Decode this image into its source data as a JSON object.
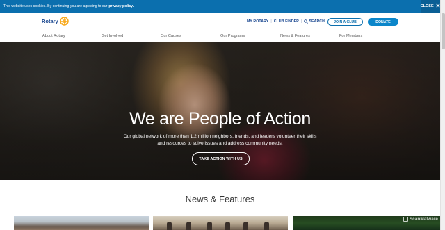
{
  "cookie_bar": {
    "text": "This website uses cookies. By continuing you are agreeing to our",
    "link": "privacy policy.",
    "close_label": "CLOSE",
    "close_glyph": "✕"
  },
  "header": {
    "logo_text": "Rotary",
    "utility_nav": [
      {
        "label": "MY ROTARY"
      },
      {
        "label": "CLUB FINDER"
      },
      {
        "label": "SEARCH",
        "icon": "search-icon"
      }
    ],
    "join_label": "JOIN A CLUB",
    "donate_label": "DONATE"
  },
  "main_nav": [
    {
      "label": "About Rotary"
    },
    {
      "label": "Get Involved"
    },
    {
      "label": "Our Causes"
    },
    {
      "label": "Our Programs"
    },
    {
      "label": "News & Features"
    },
    {
      "label": "For Members"
    }
  ],
  "hero": {
    "title": "We are People of Action",
    "subtitle": "Our global network of more than 1.2 million neighbors, friends, and leaders volunteer their skills and resources to solve issues and address community needs.",
    "cta_label": "TAKE ACTION WITH US"
  },
  "news": {
    "title": "News & Features"
  },
  "watermark": {
    "text": "ScanMalware"
  },
  "colors": {
    "brand_blue": "#17458f",
    "cookie_blue": "#0b6fae",
    "donate_blue": "#0b86ca",
    "gold": "#f7a81b"
  }
}
